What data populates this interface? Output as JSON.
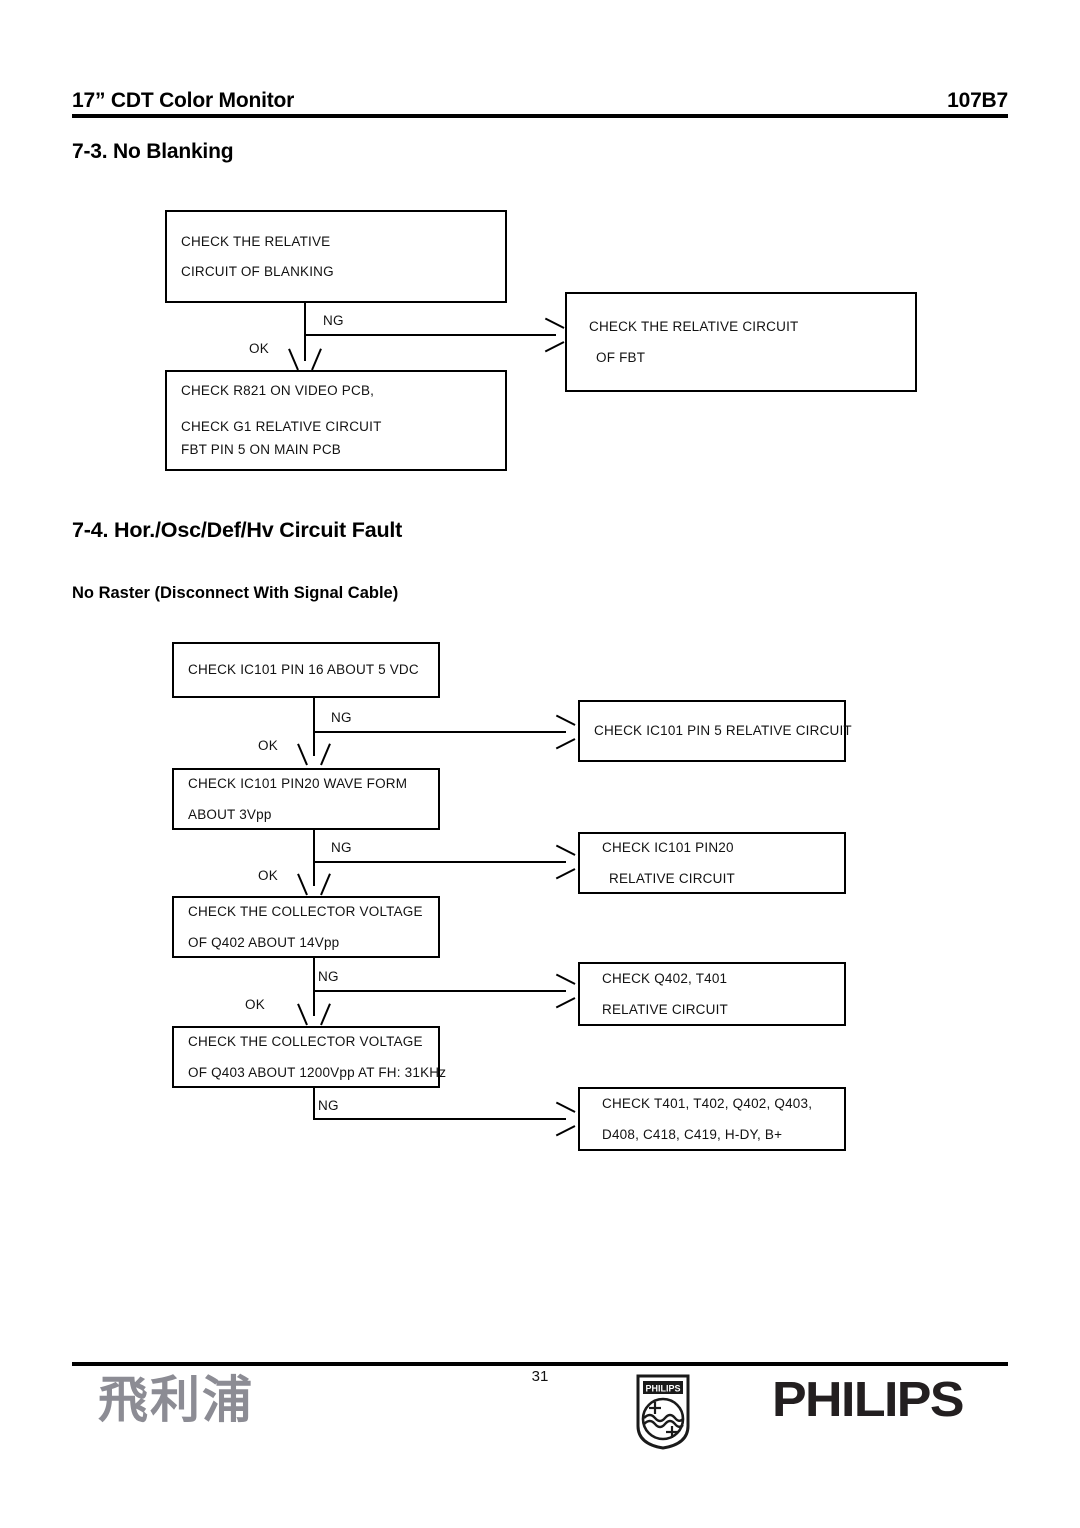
{
  "header": {
    "left_title": "17” CDT Color Monitor",
    "model": "107B7"
  },
  "sections": {
    "s73": {
      "heading": "7-3. No Blanking",
      "flowchart": {
        "boxes": [
          {
            "id": "check-blanking-circuit",
            "lines": [
              "CHECK THE RELATIVE",
              "CIRCUIT OF BLANKING"
            ]
          },
          {
            "id": "check-fbt-circuit",
            "lines": [
              "CHECK THE RELATIVE CIRCUIT",
              "OF FBT"
            ]
          },
          {
            "id": "check-r821-g1",
            "lines": [
              "CHECK R821 ON VIDEO PCB,",
              "CHECK G1 RELATIVE CIRCUIT",
              "FBT PIN 5 ON MAIN PCB"
            ]
          }
        ],
        "edge_labels": {
          "ng": "NG",
          "ok": "OK"
        }
      }
    },
    "s74": {
      "heading": "7-4.   Hor./Osc/Def/Hv Circuit Fault",
      "subheading": "No Raster (Disconnect With Signal Cable)",
      "flowchart": {
        "boxes": [
          {
            "id": "check-ic101-pin16",
            "lines": [
              "CHECK IC101 PIN 16 ABOUT 5 VDC"
            ]
          },
          {
            "id": "check-ic101-pin5-circuit",
            "lines": [
              "CHECK IC101 PIN 5 RELATIVE CIRCUIT"
            ]
          },
          {
            "id": "check-ic101-pin20-wave",
            "lines": [
              "CHECK IC101 PIN20 WAVE FORM",
              "ABOUT 3Vpp"
            ]
          },
          {
            "id": "check-ic101-pin20-circuit",
            "lines": [
              "CHECK IC101 PIN20",
              "RELATIVE CIRCUIT"
            ]
          },
          {
            "id": "check-q402-collector",
            "lines": [
              "CHECK THE COLLECTOR VOLTAGE",
              "OF Q402 ABOUT 14Vpp"
            ]
          },
          {
            "id": "check-q402-t401-circuit",
            "lines": [
              "CHECK Q402, T401",
              "RELATIVE CIRCUIT"
            ]
          },
          {
            "id": "check-q403-collector",
            "lines": [
              "CHECK THE COLLECTOR VOLTAGE",
              "OF Q403 ABOUT 1200Vpp AT FH: 31KHz"
            ]
          },
          {
            "id": "check-t401-t402-components",
            "lines": [
              "CHECK T401, T402, Q402, Q403,",
              "D408, C418, C419, H-DY, B+"
            ]
          }
        ],
        "edge_labels": {
          "ng": "NG",
          "ok": "OK"
        }
      }
    }
  },
  "footer": {
    "page_number": "31",
    "cjk_logo": "飛利浦",
    "shield_text": "PHILIPS",
    "wordmark": "PHILIPS"
  }
}
